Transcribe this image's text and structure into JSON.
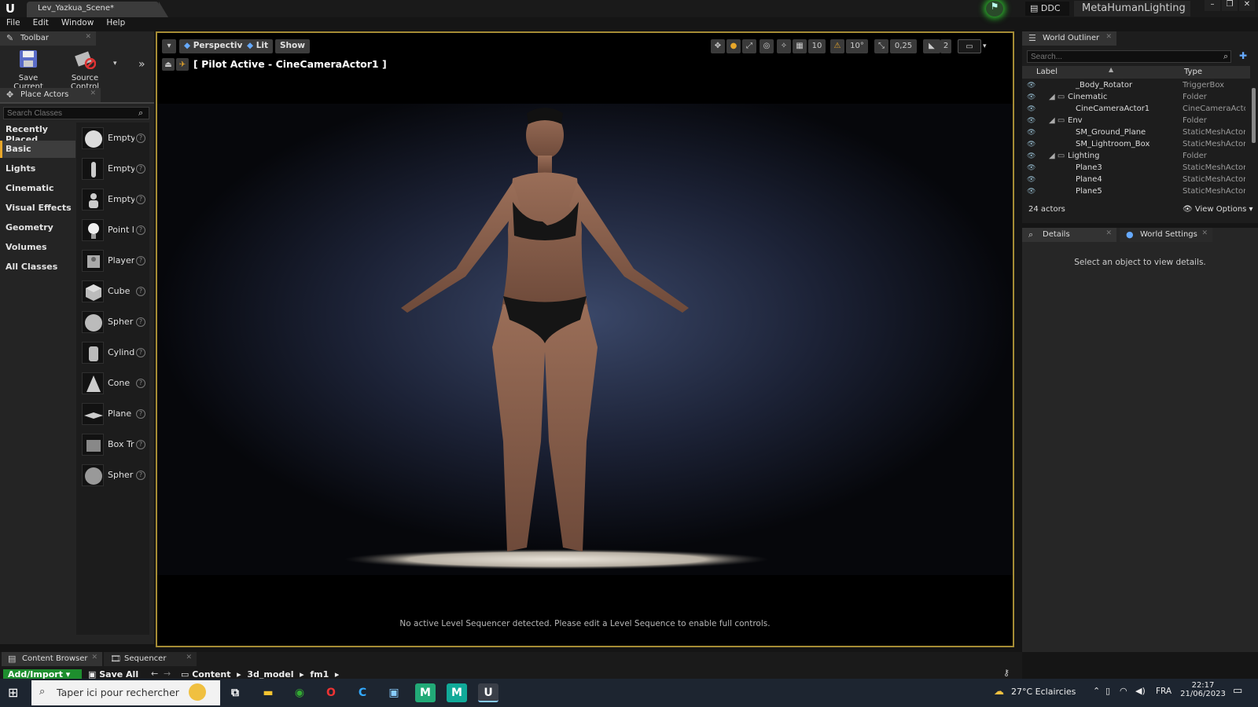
{
  "window": {
    "document_tab": "Lev_Yazkua_Scene*",
    "ddc_label": "DDC",
    "project_name": "MetaHumanLighting"
  },
  "menu": [
    "File",
    "Edit",
    "Window",
    "Help"
  ],
  "toolbar": {
    "tab_label": "Toolbar",
    "save_current": "Save Current",
    "source_control": "Source Control"
  },
  "place_actors": {
    "tab_label": "Place Actors",
    "search_placeholder": "Search Classes",
    "categories": [
      "Recently Placed",
      "Basic",
      "Lights",
      "Cinematic",
      "Visual Effects",
      "Geometry",
      "Volumes",
      "All Classes"
    ],
    "active_category": "Basic",
    "actors": [
      "Empty",
      "Empty",
      "Empty",
      "Point l",
      "Player",
      "Cube",
      "Spher",
      "Cylind",
      "Cone",
      "Plane",
      "Box Tr",
      "Spher"
    ]
  },
  "viewport": {
    "perspective": "Perspective",
    "lit": "Lit",
    "show": "Show",
    "pilot_label": "[ Pilot Active - CineCameraActor1 ]",
    "grid_snap": "10",
    "rotation_snap": "10°",
    "scale_snap": "0,25",
    "camera_speed": "2",
    "message": "No active Level Sequencer detected. Please edit a Level Sequence to enable full controls."
  },
  "outliner": {
    "tab_label": "World Outliner",
    "search_placeholder": "Search...",
    "col_label": "Label",
    "col_type": "Type",
    "rows": [
      {
        "label": "_Body_Rotator",
        "type": "TriggerBox",
        "indent": 2
      },
      {
        "label": "Cinematic",
        "type": "Folder",
        "indent": 1
      },
      {
        "label": "CineCameraActor1",
        "type": "CineCameraActo",
        "indent": 2
      },
      {
        "label": "Env",
        "type": "Folder",
        "indent": 1
      },
      {
        "label": "SM_Ground_Plane",
        "type": "StaticMeshActor",
        "indent": 2
      },
      {
        "label": "SM_Lightroom_Box",
        "type": "StaticMeshActor",
        "indent": 2
      },
      {
        "label": "Lighting",
        "type": "Folder",
        "indent": 1
      },
      {
        "label": "Plane3",
        "type": "StaticMeshActor",
        "indent": 2
      },
      {
        "label": "Plane4",
        "type": "StaticMeshActor",
        "indent": 2
      },
      {
        "label": "Plane5",
        "type": "StaticMeshActor",
        "indent": 2
      }
    ],
    "count": "24 actors",
    "view_options": "View Options"
  },
  "details": {
    "tab_label": "Details",
    "world_settings": "World Settings",
    "empty_message": "Select an object to view details."
  },
  "bottom": {
    "content_browser": "Content Browser",
    "sequencer": "Sequencer",
    "add_import": "Add/Import",
    "save_all": "Save All",
    "breadcrumb": [
      "Content",
      "3d_model",
      "fm1"
    ]
  },
  "taskbar": {
    "search_placeholder": "Taper ici pour rechercher",
    "weather": "27°C  Eclaircies",
    "language": "FRA",
    "time": "22:17",
    "date": "21/06/2023"
  },
  "colors": {
    "accent": "#e8a72a",
    "viewport_border": "#a58c35",
    "panel_bg": "#242424"
  }
}
